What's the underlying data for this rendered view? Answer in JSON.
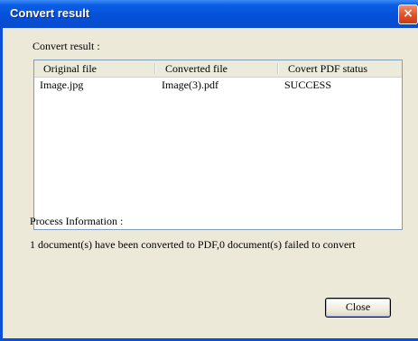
{
  "window": {
    "title": "Convert result",
    "close_icon": "×"
  },
  "main": {
    "convert_label": "Convert result :",
    "columns": [
      "Original file",
      "Converted file",
      "Covert PDF status"
    ],
    "rows": [
      {
        "original": "Image.jpg",
        "converted": "Image(3).pdf",
        "status": "SUCCESS"
      }
    ],
    "process_label": "Process Information :",
    "process_text": "1 document(s) have been converted to PDF,0 document(s) failed to convert",
    "close_button": "Close"
  }
}
